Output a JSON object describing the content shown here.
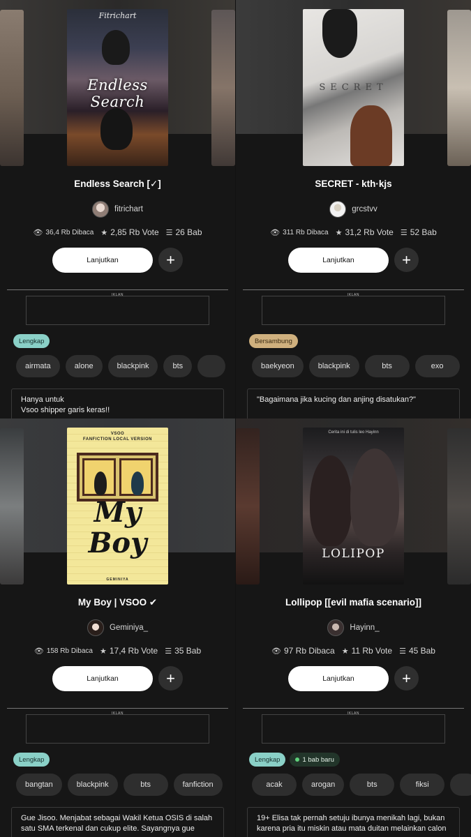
{
  "panels": [
    {
      "cover": {
        "title": "Endless Search",
        "author_credit": "Fitrichart"
      },
      "title": "Endless Search [✓]",
      "author": "fitrichart",
      "reads": "36,4 Rb Dibaca",
      "votes": "2,85 Rb Vote",
      "chapters": "26 Bab",
      "continue_label": "Lanjutkan",
      "add_label": "+",
      "ad_label": "IKLAN",
      "status": "Lengkap",
      "tags": [
        "airmata",
        "alone",
        "blackpink",
        "bts",
        ""
      ],
      "description": "Hanya untuk\nVsoo shipper garis keras!!"
    },
    {
      "cover": {
        "title": "SECRET"
      },
      "title": "SECRET - kth·kjs",
      "author": "grcstvv",
      "reads": "311 Rb Dibaca",
      "votes": "31,2 Rb Vote",
      "chapters": "52 Bab",
      "continue_label": "Lanjutkan",
      "add_label": "+",
      "ad_label": "IKLAN",
      "status": "Bersambung",
      "tags": [
        "baekyeon",
        "blackpink",
        "bts",
        "exo"
      ],
      "description": "\"Bagaimana jika kucing dan anjing disatukan?\""
    },
    {
      "cover": {
        "top_text": "VSOO\nFANFICTION LOCAL VERSION",
        "title": "My\nBoy",
        "author_credit": "GEMINIYA"
      },
      "title": "My Boy | VSOO ✔",
      "author": "Geminiya_",
      "reads": "158 Rb Dibaca",
      "votes": "17,4 Rb Vote",
      "chapters": "35 Bab",
      "continue_label": "Lanjutkan",
      "add_label": "+",
      "ad_label": "IKLAN",
      "status": "Lengkap",
      "tags": [
        "bangtan",
        "blackpink",
        "bts",
        "fanfiction"
      ],
      "description": "Gue Jisoo. Menjabat sebagai Wakil Ketua OSIS di salah satu SMA terkenal dan cukup elite. Sayangnya gue punya"
    },
    {
      "cover": {
        "top_text": "Cerita ini di tulis leo Hayinn",
        "title": "LOLIPOP"
      },
      "title": "Lollipop [[evil mafia scenario]]",
      "author": "Hayinn_",
      "reads": "97 Rb Dibaca",
      "votes": "11 Rb Vote",
      "chapters": "45 Bab",
      "continue_label": "Lanjutkan",
      "add_label": "+",
      "ad_label": "IKLAN",
      "status": "Lengkap",
      "new_badge": "1 bab baru",
      "tags": [
        "acak",
        "arogan",
        "bts",
        "fiksi",
        ""
      ],
      "description": "19+ Elisa tak pernah setuju ibunya menikah lagi, bukan karena pria itu miskin atau mata duitan melainkan calon"
    }
  ],
  "colors": {
    "background": "#161616",
    "complete_badge": "#8ad0c7",
    "ongoing_badge": "#cfb07e",
    "chip": "#2e2e2e",
    "button": "#ffffff"
  },
  "icons": {
    "reads": "eye-icon",
    "votes": "star-icon",
    "chapters": "list-icon",
    "add": "plus-icon",
    "new": "green-dot-icon"
  }
}
